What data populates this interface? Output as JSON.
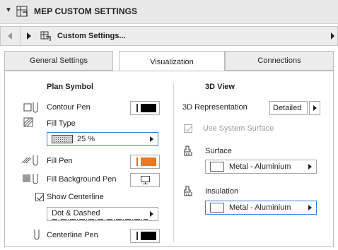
{
  "header": {
    "title": "MEP CUSTOM SETTINGS"
  },
  "navbar": {
    "label": "Custom Settings..."
  },
  "tabs": [
    {
      "label": "General Settings"
    },
    {
      "label": "Visualization"
    },
    {
      "label": "Connections"
    }
  ],
  "plan": {
    "heading": "Plan Symbol",
    "contour_pen": "Contour Pen",
    "fill_type": "Fill Type",
    "fill_value": "25 %",
    "fill_pen": "Fill Pen",
    "fill_bg_pen": "Fill Background Pen",
    "show_centerline": "Show Centerline",
    "line_type": "Dot & Dashed",
    "centerline_pen": "Centerline Pen"
  },
  "view3d": {
    "heading": "3D View",
    "representation_label": "3D Representation",
    "representation_value": "Detailed",
    "use_system_surface": "Use System Surface",
    "surface_label": "Surface",
    "surface_value": "Metal - Aluminium",
    "insulation_label": "Insulation",
    "insulation_value": "Metal - Aluminium"
  },
  "colors": {
    "fill_pen": "#f07818",
    "accent": "#3b82d6"
  }
}
